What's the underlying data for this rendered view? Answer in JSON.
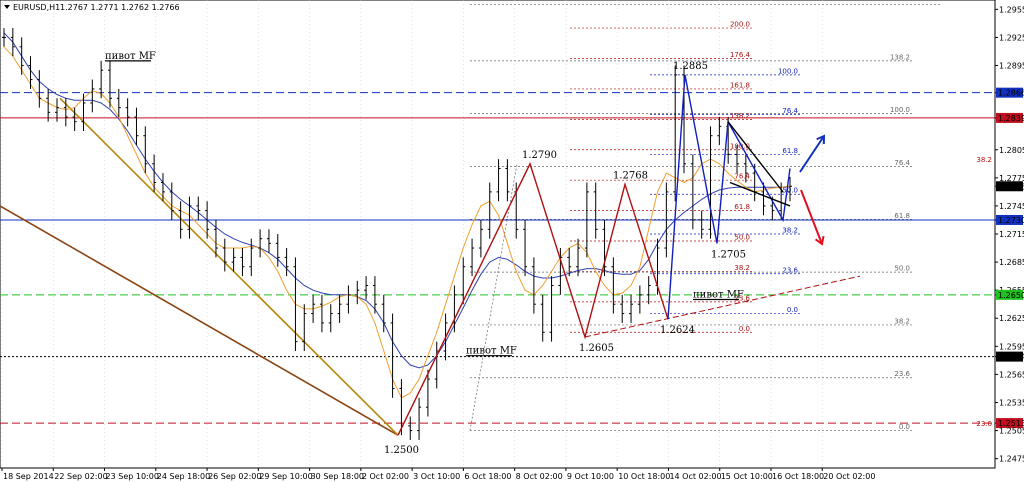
{
  "header": {
    "symbol": "EURUSD,H1",
    "ohlc": "1.2767 1.2771 1.2762 1.2766"
  },
  "colors": {
    "background": "#ffffff",
    "grid": "#c8c8c8",
    "candle": "#000000",
    "ma_fast": "#f0a030",
    "ma_slow": "#3040b0",
    "level_blue": "#1030c0",
    "level_red": "#c01020",
    "level_green": "#20c020",
    "level_black": "#000000",
    "trend_brown": "#8b4513",
    "trend_gold": "#b8860b",
    "pattern_red": "#b01010",
    "pattern_blue": "#1020c0",
    "fib_red": "#b01010",
    "fib_blue": "#1020c0",
    "fib_gray": "#666666",
    "arrow_up": "#1030c0",
    "arrow_down": "#e01020"
  },
  "chart_data": {
    "type": "candlestick",
    "title": "",
    "ylim": [
      1.2465,
      1.2965
    ],
    "x_tick_labels": [
      "18 Sep 2014",
      "22 Sep 02:00",
      "23 Sep 10:00",
      "24 Sep 18:00",
      "26 Sep 02:00",
      "29 Sep 10:00",
      "30 Sep 18:00",
      "2 Oct 02:00",
      "3 Oct 10:00",
      "6 Oct 18:00",
      "8 Oct 02:00",
      "9 Oct 10:00",
      "10 Oct 18:00",
      "14 Oct 02:00",
      "15 Oct 10:00",
      "16 Oct 18:00",
      "20 Oct 02:00"
    ],
    "y_tick_labels": [
      "1.2955",
      "1.2925",
      "1.2895",
      "1.2866",
      "1.2839",
      "1.2805",
      "1.2775",
      "1.2766",
      "1.2745",
      "1.2730",
      "1.2715",
      "1.2685",
      "1.2655",
      "1.2650",
      "1.2625",
      "1.2595",
      "1.2584",
      "1.2565",
      "1.2535",
      "1.2513",
      "1.2505",
      "1.2475"
    ],
    "highlighted_levels": [
      {
        "label": "1.2866",
        "value": 1.2866,
        "color": "#1030c0",
        "style": "dashed"
      },
      {
        "label": "1.2839",
        "value": 1.2839,
        "color": "#c01020",
        "style": "solid"
      },
      {
        "label": "1.2766",
        "value": 1.2766,
        "color": "#000000",
        "style": "none"
      },
      {
        "label": "1.2730",
        "value": 1.273,
        "color": "#1030c0",
        "style": "solid"
      },
      {
        "label": "1.2650",
        "value": 1.265,
        "color": "#20c020",
        "style": "dashed"
      },
      {
        "label": "1.2584",
        "value": 1.2584,
        "color": "#000000",
        "style": "dotted"
      },
      {
        "label": "1.2513",
        "value": 1.2513,
        "color": "#c01020",
        "style": "dashed"
      }
    ],
    "price_series": [
      1.2925,
      1.2915,
      1.2895,
      1.288,
      1.286,
      1.2845,
      1.285,
      1.284,
      1.2835,
      1.2855,
      1.287,
      1.289,
      1.286,
      1.285,
      1.284,
      1.282,
      1.279,
      1.277,
      1.276,
      1.274,
      1.272,
      1.2745,
      1.274,
      1.272,
      1.27,
      1.2685,
      1.269,
      1.268,
      1.27,
      1.271,
      1.2705,
      1.269,
      1.268,
      1.26,
      1.263,
      1.264,
      1.262,
      1.263,
      1.264,
      1.265,
      1.2655,
      1.266,
      1.264,
      1.262,
      1.255,
      1.251,
      1.2505,
      1.253,
      1.256,
      1.259,
      1.262,
      1.265,
      1.268,
      1.27,
      1.272,
      1.276,
      1.2785,
      1.276,
      1.272,
      1.268,
      1.264,
      1.261,
      1.266,
      1.269,
      1.268,
      1.27,
      1.276,
      1.272,
      1.268,
      1.264,
      1.263,
      1.264,
      1.265,
      1.266,
      1.27,
      1.276,
      1.2885,
      1.279,
      1.273,
      1.272,
      1.282,
      1.283,
      1.28,
      1.279,
      1.278,
      1.276,
      1.2745,
      1.274,
      1.276,
      1.2766
    ],
    "ma_fast": [
      1.2915,
      1.2905,
      1.289,
      1.2875,
      1.286,
      1.2855,
      1.285,
      1.2848,
      1.285,
      1.286,
      1.2868,
      1.2865,
      1.2855,
      1.284,
      1.282,
      1.28,
      1.278,
      1.2765,
      1.2755,
      1.2745,
      1.274,
      1.2735,
      1.2725,
      1.2715,
      1.2705,
      1.27,
      1.27,
      1.27,
      1.2702,
      1.27,
      1.269,
      1.2675,
      1.2655,
      1.264,
      1.2635,
      1.2635,
      1.2638,
      1.2642,
      1.2648,
      1.265,
      1.2648,
      1.264,
      1.262,
      1.259,
      1.256,
      1.254,
      1.2545,
      1.256,
      1.2585,
      1.261,
      1.264,
      1.267,
      1.27,
      1.2725,
      1.2745,
      1.275,
      1.2735,
      1.2705,
      1.2675,
      1.2655,
      1.265,
      1.266,
      1.2675,
      1.269,
      1.27,
      1.2705,
      1.2695,
      1.2675,
      1.266,
      1.265,
      1.2652,
      1.266,
      1.268,
      1.272,
      1.276,
      1.278,
      1.2775,
      1.277,
      1.2775,
      1.279,
      1.2795,
      1.279,
      1.278,
      1.2772,
      1.2765,
      1.276,
      1.2762,
      1.2764,
      1.2765,
      1.2766
    ],
    "ma_slow": [
      1.293,
      1.292,
      1.2905,
      1.289,
      1.2878,
      1.287,
      1.2864,
      1.286,
      1.2858,
      1.2858,
      1.2858,
      1.2855,
      1.2848,
      1.2838,
      1.2825,
      1.281,
      1.2795,
      1.2782,
      1.277,
      1.276,
      1.2752,
      1.2745,
      1.2738,
      1.273,
      1.2722,
      1.2715,
      1.271,
      1.2706,
      1.2703,
      1.27,
      1.2695,
      1.2688,
      1.2678,
      1.2668,
      1.266,
      1.2655,
      1.2652,
      1.265,
      1.265,
      1.265,
      1.2648,
      1.2644,
      1.2635,
      1.262,
      1.26,
      1.2585,
      1.2575,
      1.2572,
      1.2575,
      1.2585,
      1.26,
      1.2618,
      1.2636,
      1.2655,
      1.2672,
      1.2685,
      1.269,
      1.2688,
      1.2682,
      1.2675,
      1.267,
      1.2668,
      1.2668,
      1.267,
      1.2673,
      1.2676,
      1.2678,
      1.2678,
      1.2676,
      1.2673,
      1.2672,
      1.2672,
      1.2676,
      1.2688,
      1.2705,
      1.272,
      1.273,
      1.2738,
      1.2745,
      1.2752,
      1.2758,
      1.2762,
      1.2764,
      1.2765,
      1.2765,
      1.2765,
      1.2765,
      1.2765,
      1.2765,
      1.2766
    ],
    "pattern_points": [
      {
        "label": "1.2790",
        "value": 1.279
      },
      {
        "label": "1.2500",
        "value": 1.25
      },
      {
        "label": "1.2768",
        "value": 1.2768
      },
      {
        "label": "1.2605",
        "value": 1.2605
      },
      {
        "label": "1.2885",
        "value": 1.2885
      },
      {
        "label": "1.2624",
        "value": 1.2624
      },
      {
        "label": "1.2705",
        "value": 1.2705
      }
    ],
    "annotations": [
      {
        "text": "пивот MF"
      },
      {
        "text": "пивот MF"
      },
      {
        "text": "пивот MF"
      }
    ],
    "fib_labels_red": [
      "200.0",
      "176.4",
      "161.8",
      "138.2",
      "100.0",
      "76.4",
      "61.8",
      "50.0",
      "38.2",
      "23.6",
      "0.0"
    ],
    "fib_labels_blue": [
      "100.0",
      "76.4",
      "61.8",
      "50.0",
      "38.2",
      "23.6",
      "0.0"
    ],
    "fib_labels_gray": [
      "138.2",
      "100.0",
      "76.4",
      "61.8",
      "50.0",
      "38.2",
      "23.6",
      "0.0"
    ],
    "fib_labels_right": [
      "38.2",
      "23.6"
    ]
  }
}
